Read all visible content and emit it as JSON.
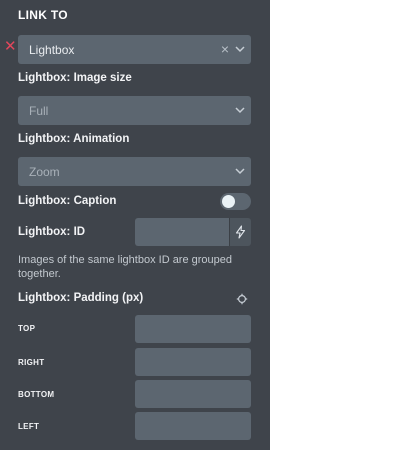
{
  "section_title": "LINK TO",
  "link_to": {
    "value": "Lightbox"
  },
  "image_size": {
    "label": "Lightbox: Image size",
    "value": "Full"
  },
  "animation": {
    "label": "Lightbox: Animation",
    "value": "Zoom"
  },
  "caption": {
    "label": "Lightbox: Caption",
    "enabled": false
  },
  "lightbox_id": {
    "label": "Lightbox: ID",
    "value": "",
    "help": "Images of the same lightbox ID are grouped together."
  },
  "padding": {
    "label": "Lightbox: Padding (px)",
    "sides": [
      {
        "label": "TOP",
        "value": ""
      },
      {
        "label": "RIGHT",
        "value": ""
      },
      {
        "label": "BOTTOM",
        "value": ""
      },
      {
        "label": "LEFT",
        "value": ""
      }
    ]
  },
  "colors": {
    "panel_bg": "#3f444b",
    "field_bg": "#5c6670",
    "remove_red": "#e2475c"
  },
  "icons": [
    "remove-icon",
    "clear-icon",
    "chevron-down-icon",
    "toggle",
    "bolt-icon",
    "reset-icon"
  ]
}
